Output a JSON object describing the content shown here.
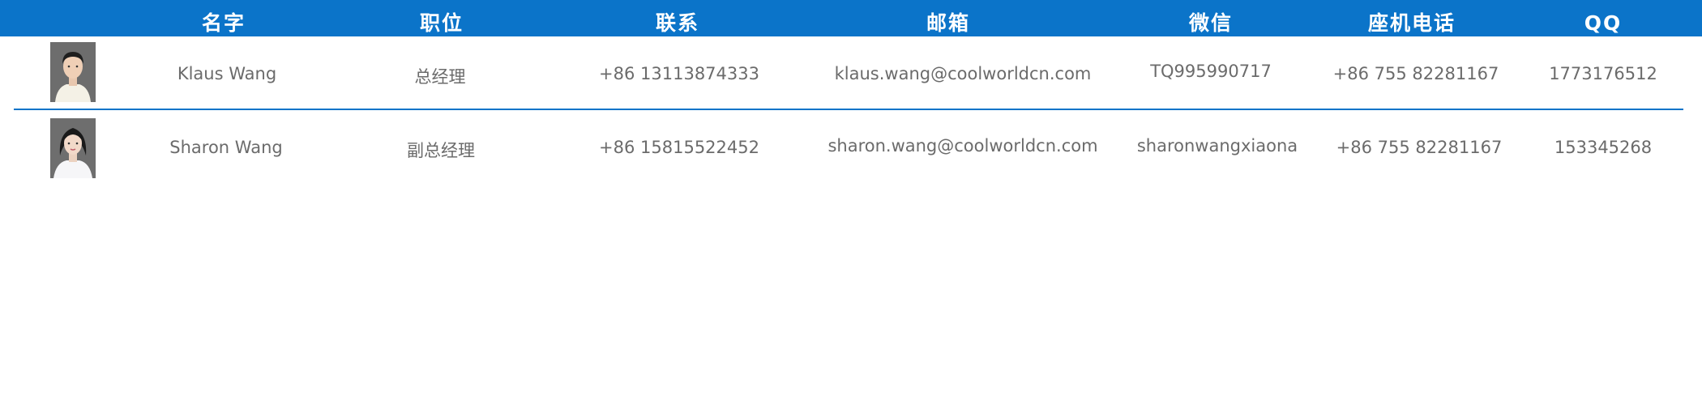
{
  "table": {
    "headers": [
      "名字",
      "职位",
      "联系",
      "邮箱",
      "微信",
      "座机电话",
      "QQ"
    ],
    "rows": [
      {
        "name": "Klaus Wang",
        "title": "总经理",
        "phone": "+86 13113874333",
        "email": "klaus.wang@coolworldcn.com",
        "wechat": "TQ995990717",
        "landline": "+86 755 82281167",
        "qq": "1773176512"
      },
      {
        "name": "Sharon Wang",
        "title": "副总经理",
        "phone": "+86 15815522452",
        "email": "sharon.wang@coolworldcn.com",
        "wechat": "sharonwangxiaona",
        "landline": "+86 755 82281167",
        "qq": "153345268"
      }
    ]
  },
  "colors": {
    "header_bg": "#0b74c9",
    "header_text": "#ffffff",
    "cell_text": "#6b6b6b",
    "divider": "#0b74c9"
  }
}
